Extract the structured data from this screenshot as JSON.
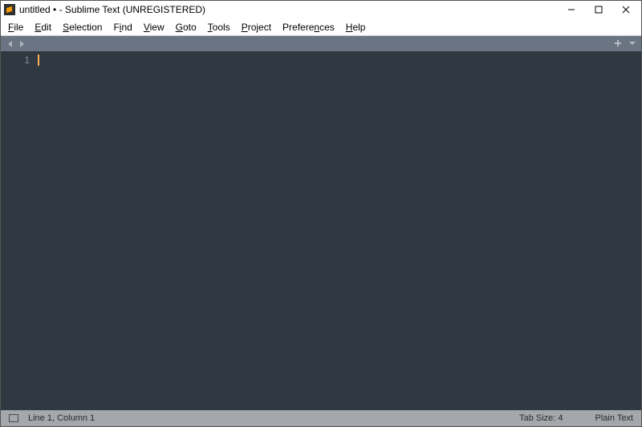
{
  "titlebar": {
    "title": "untitled • - Sublime Text (UNREGISTERED)"
  },
  "menubar": {
    "items": [
      {
        "u": "F",
        "rest": "ile"
      },
      {
        "u": "E",
        "rest": "dit"
      },
      {
        "u": "S",
        "rest": "election"
      },
      {
        "u": "",
        "rest": "F",
        "u2": "i",
        "rest2": "nd"
      },
      {
        "u": "V",
        "rest": "iew"
      },
      {
        "u": "G",
        "rest": "oto"
      },
      {
        "u": "T",
        "rest": "ools"
      },
      {
        "u": "P",
        "rest": "roject"
      },
      {
        "u": "",
        "rest": "Prefere",
        "u2": "n",
        "rest2": "ces"
      },
      {
        "u": "H",
        "rest": "elp"
      }
    ]
  },
  "editor": {
    "line_number": "1"
  },
  "statusbar": {
    "position": "Line 1, Column 1",
    "tabsize": "Tab Size: 4",
    "syntax": "Plain Text"
  }
}
